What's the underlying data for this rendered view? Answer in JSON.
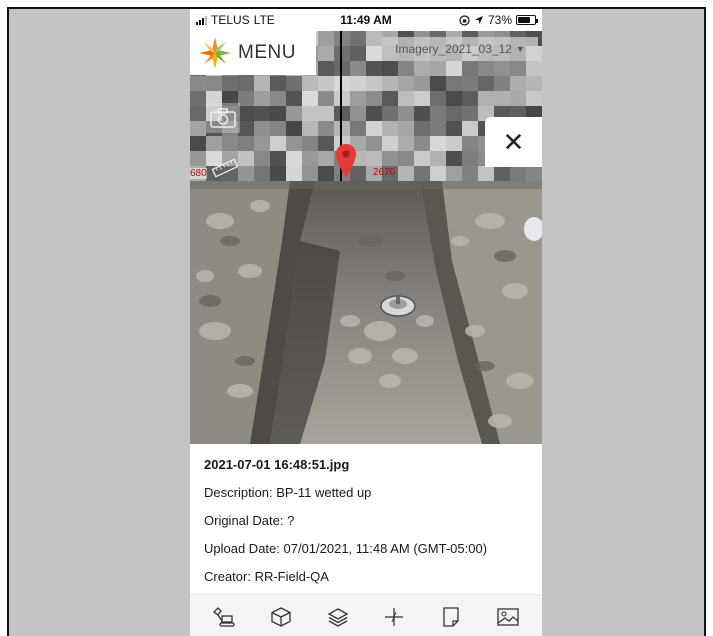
{
  "status_bar": {
    "carrier": "TELUS",
    "network": "LTE",
    "time": "11:49 AM",
    "battery": "73%",
    "battery_level": 0.73
  },
  "map": {
    "menu_label": "MENU",
    "imagery_layer": "Imagery_2021_03_12",
    "scale_left": "680",
    "scale_right": "2670",
    "pin_color": "#e53935"
  },
  "photo_info": {
    "filename": "2021-07-01 16:48:51.jpg",
    "description": "Description: BP-11 wetted up",
    "original_date": "Original Date: ?",
    "upload_date": "Upload Date: 07/01/2021, 11:48 AM (GMT-05:00)",
    "creator": "Creator: RR-Field-QA"
  },
  "toolbar": {
    "tools": [
      "excavator-icon",
      "cube-icon",
      "layers-icon",
      "crosshair-icon",
      "note-icon",
      "image-icon"
    ]
  },
  "colors": {
    "accent_orange": "#f28c28",
    "accent_green": "#7cb342",
    "pin_red": "#e53935"
  }
}
